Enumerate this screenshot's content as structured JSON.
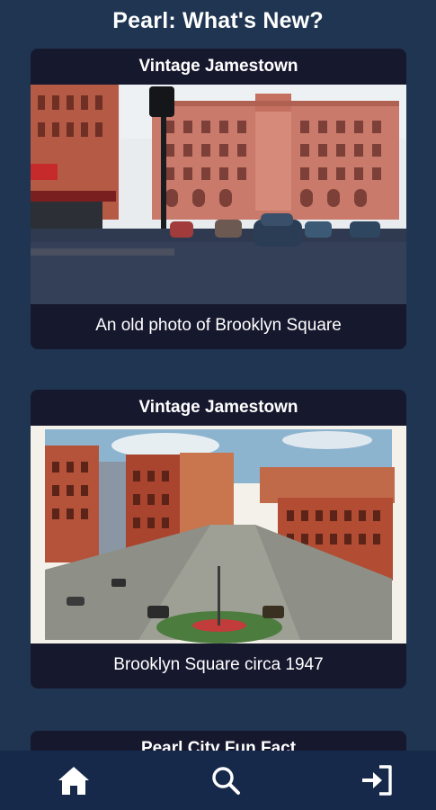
{
  "header": {
    "title": "Pearl: What's New?"
  },
  "cards": [
    {
      "title": "Vintage Jamestown",
      "caption": "An old photo of Brooklyn Square",
      "image": "vintage-street-photo"
    },
    {
      "title": "Vintage Jamestown",
      "caption": "Brooklyn Square circa 1947",
      "image": "postcard-aerial-view"
    },
    {
      "title": "Pearl City Fun Fact"
    }
  ],
  "nav": {
    "items": [
      {
        "icon": "home-icon"
      },
      {
        "icon": "search-icon"
      },
      {
        "icon": "sign-in-icon"
      }
    ]
  },
  "colors": {
    "background": "#1f3551",
    "card": "#16182e",
    "nav": "#17294a",
    "text": "#ffffff"
  }
}
